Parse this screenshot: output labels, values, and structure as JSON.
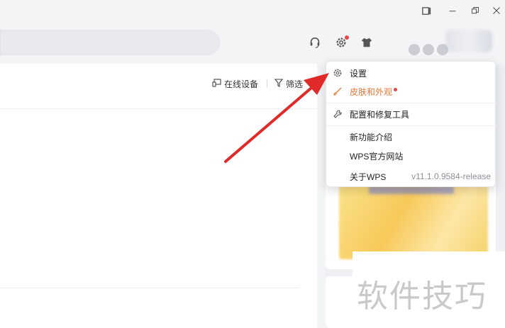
{
  "toolbar": {
    "online_devices": "在线设备",
    "filter": "筛选"
  },
  "menu": {
    "items": [
      {
        "label": "设置"
      },
      {
        "label": "皮肤和外观"
      },
      {
        "label": "配置和修复工具"
      },
      {
        "label": "新功能介绍"
      },
      {
        "label": "WPS官方网站"
      },
      {
        "label": "关于WPS",
        "version": "v11.1.0.9584-release"
      }
    ]
  },
  "watermark": "软件技巧",
  "colors": {
    "accent_orange": "#e8773a",
    "notification_red": "#e5484d",
    "arrow_red": "#e02a2a"
  },
  "icons": [
    "tablet-mode-icon",
    "minimize-icon",
    "restore-icon",
    "close-icon",
    "headset-icon",
    "gear-icon",
    "tshirt-icon",
    "brush-icon",
    "wrench-icon",
    "device-icon",
    "filter-icon"
  ]
}
